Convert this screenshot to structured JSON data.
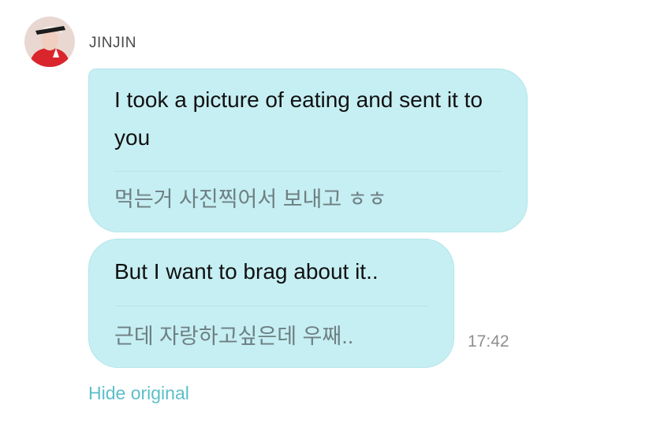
{
  "sender": {
    "name": "JINJIN",
    "avatar_icon": "profile-photo-avatar"
  },
  "messages": [
    {
      "translated": "I took a picture of eating and sent it to you",
      "original": "먹는거 사진찍어서 보내고 ㅎㅎ"
    },
    {
      "translated": "But I want to brag about it..",
      "original": "근데 자랑하고싶은데 우째.."
    }
  ],
  "timestamp": "17:42",
  "hide_original_label": "Hide original",
  "colors": {
    "bubble": "#c6eff3",
    "link": "#5bbfc9",
    "original_text": "#6d7f82"
  }
}
